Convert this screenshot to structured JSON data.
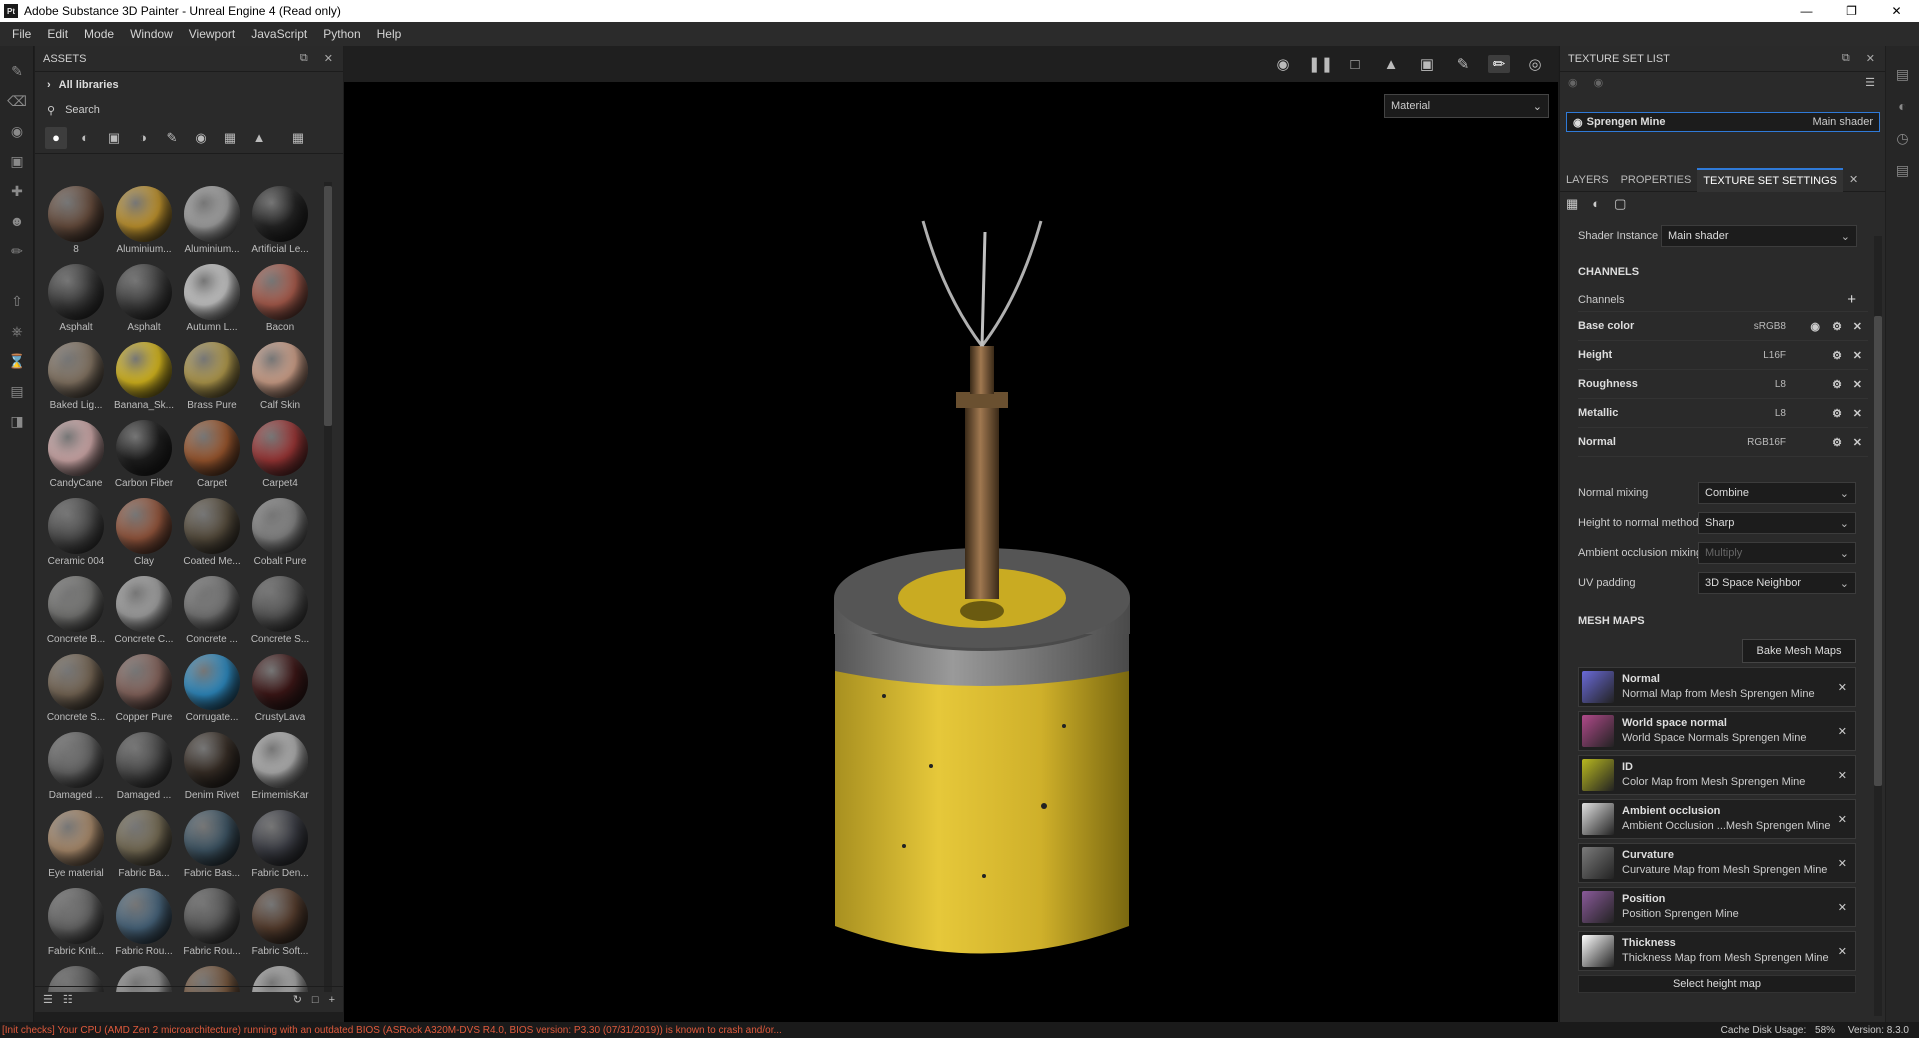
{
  "window": {
    "title": "Adobe Substance 3D Painter - Unreal Engine 4 (Read only)",
    "logo": "Pt"
  },
  "menu": [
    "File",
    "Edit",
    "Mode",
    "Window",
    "Viewport",
    "JavaScript",
    "Python",
    "Help"
  ],
  "assets": {
    "title": "ASSETS",
    "library": "All libraries",
    "search_placeholder": "Search",
    "items": [
      {
        "label": "8",
        "color": "#6b5040"
      },
      {
        "label": "Aluminium...",
        "color": "#c89a30"
      },
      {
        "label": "Aluminium...",
        "color": "#a8a8a8"
      },
      {
        "label": "Artificial Le...",
        "color": "#262626"
      },
      {
        "label": "Asphalt",
        "color": "#3e3e3e"
      },
      {
        "label": "Asphalt",
        "color": "#444444"
      },
      {
        "label": "Autumn L...",
        "color": "#d0d0d0"
      },
      {
        "label": "Bacon",
        "color": "#b06050"
      },
      {
        "label": "Baked Lig...",
        "color": "#8a7a68"
      },
      {
        "label": "Banana_Sk...",
        "color": "#e0c020"
      },
      {
        "label": "Brass Pure",
        "color": "#b8a050"
      },
      {
        "label": "Calf Skin",
        "color": "#d8a890"
      },
      {
        "label": "CandyCane",
        "color": "#d8b0b0"
      },
      {
        "label": "Carbon Fiber",
        "color": "#202020"
      },
      {
        "label": "Carpet",
        "color": "#a05a30"
      },
      {
        "label": "Carpet4",
        "color": "#a03838"
      },
      {
        "label": "Ceramic 004",
        "color": "#505050"
      },
      {
        "label": "Clay",
        "color": "#9a5a40"
      },
      {
        "label": "Coated Me...",
        "color": "#5a5040"
      },
      {
        "label": "Cobalt Pure",
        "color": "#8a8a8a"
      },
      {
        "label": "Concrete B...",
        "color": "#7a7a78"
      },
      {
        "label": "Concrete C...",
        "color": "#a8a8a8"
      },
      {
        "label": "Concrete ...",
        "color": "#7a7a7a"
      },
      {
        "label": "Concrete S...",
        "color": "#5a5a5a"
      },
      {
        "label": "Concrete S...",
        "color": "#7a6a58"
      },
      {
        "label": "Copper Pure",
        "color": "#8a6860"
      },
      {
        "label": "Corrugate...",
        "color": "#3090c8"
      },
      {
        "label": "CrustyLava",
        "color": "#401818"
      },
      {
        "label": "Damaged ...",
        "color": "#6a6a6a"
      },
      {
        "label": "Damaged ...",
        "color": "#505050"
      },
      {
        "label": "Denim Rivet",
        "color": "#3a3028"
      },
      {
        "label": "ErimemisKar",
        "color": "#b8b8b8"
      },
      {
        "label": "Eye material",
        "color": "#b09070"
      },
      {
        "label": "Fabric Ba...",
        "color": "#7a7058"
      },
      {
        "label": "Fabric Bas...",
        "color": "#405868"
      },
      {
        "label": "Fabric Den...",
        "color": "#3e4048"
      },
      {
        "label": "Fabric Knit...",
        "color": "#6a6a6a"
      },
      {
        "label": "Fabric Rou...",
        "color": "#4a6880"
      },
      {
        "label": "Fabric Rou...",
        "color": "#5a5a5a"
      },
      {
        "label": "Fabric Soft...",
        "color": "#5a4030"
      },
      {
        "label": "",
        "color": "#5a5a5a"
      },
      {
        "label": "",
        "color": "#9a9a9a"
      },
      {
        "label": "",
        "color": "#7a5a40"
      },
      {
        "label": "",
        "color": "#b0b0b0"
      }
    ]
  },
  "viewport": {
    "material_select": "Material"
  },
  "texture_set_list": {
    "title": "TEXTURE SET LIST",
    "set_name": "Sprengen Mine",
    "shader": "Main shader"
  },
  "tabs": [
    "LAYERS",
    "PROPERTIES",
    "TEXTURE SET SETTINGS"
  ],
  "settings": {
    "shader_instance_label": "Shader Instance",
    "shader_instance_value": "Main shader",
    "channels_header": "CHANNELS",
    "channels_label": "Channels",
    "channels": [
      {
        "name": "Base color",
        "format": "sRGB8"
      },
      {
        "name": "Height",
        "format": "L16F"
      },
      {
        "name": "Roughness",
        "format": "L8"
      },
      {
        "name": "Metallic",
        "format": "L8"
      },
      {
        "name": "Normal",
        "format": "RGB16F"
      }
    ],
    "options": [
      {
        "label": "Normal mixing",
        "value": "Combine",
        "disabled": false
      },
      {
        "label": "Height to normal method",
        "value": "Sharp",
        "disabled": false
      },
      {
        "label": "Ambient occlusion mixing",
        "value": "Multiply",
        "disabled": true
      },
      {
        "label": "UV padding",
        "value": "3D Space Neighbor",
        "disabled": false
      }
    ],
    "mesh_maps_header": "MESH MAPS",
    "bake_button": "Bake Mesh Maps",
    "mesh_maps": [
      {
        "name": "Normal",
        "desc": "Normal Map from Mesh Sprengen Mine",
        "color": "#6a6ad8"
      },
      {
        "name": "World space normal",
        "desc": "World Space Normals Sprengen Mine",
        "color": "#b04a8a"
      },
      {
        "name": "ID",
        "desc": "Color Map from Mesh Sprengen Mine",
        "color": "#b8b820"
      },
      {
        "name": "Ambient occlusion",
        "desc": "Ambient Occlusion ...Mesh Sprengen Mine",
        "color": "#e0e0e0"
      },
      {
        "name": "Curvature",
        "desc": "Curvature Map from Mesh Sprengen Mine",
        "color": "#7a7a7a"
      },
      {
        "name": "Position",
        "desc": "Position Sprengen Mine",
        "color": "#8a5a9a"
      },
      {
        "name": "Thickness",
        "desc": "Thickness Map from Mesh Sprengen Mine",
        "color": "#ffffff"
      }
    ],
    "select_height": "Select height map"
  },
  "status": {
    "error": "[Init checks] Your CPU (AMD Zen 2 microarchitecture) running with an outdated BIOS (ASRock A320M-DVS R4.0, BIOS version: P3.30 (07/31/2019)) is known to crash and/or...",
    "cache": "Cache Disk Usage:",
    "cache_pct": "58%",
    "version": "Version: 8.3.0"
  }
}
